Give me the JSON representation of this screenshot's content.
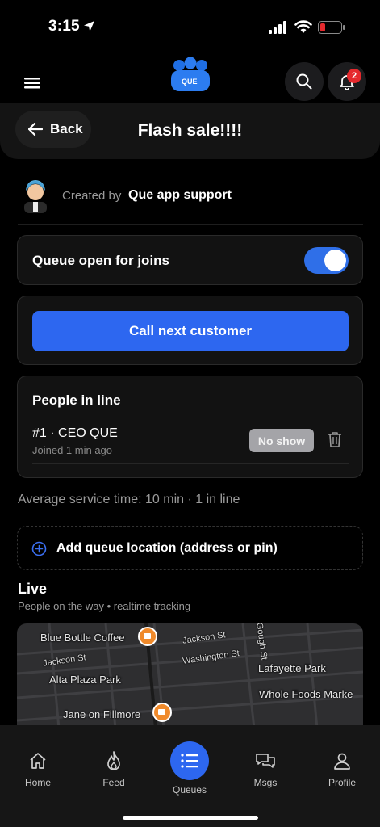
{
  "status_bar": {
    "time": "3:15"
  },
  "header": {
    "logo_text": "QUE",
    "notification_count": "2"
  },
  "title_bar": {
    "back_label": "Back",
    "title": "Flash sale!!!!"
  },
  "creator": {
    "created_by_label": "Created by",
    "name": "Que app support"
  },
  "queue_toggle": {
    "label": "Queue open for joins",
    "on": true
  },
  "call_next": {
    "label": "Call next customer"
  },
  "people_in_line": {
    "title": "People in line",
    "rows": [
      {
        "name": "#1 · CEO QUE",
        "joined": "Joined 1 min ago",
        "action": "No show"
      }
    ]
  },
  "average_line": "Average service time: 10 min · 1 in line",
  "add_location": {
    "label": "Add queue location (address or pin)"
  },
  "live": {
    "title": "Live",
    "subtitle": "People on the way • realtime tracking"
  },
  "map": {
    "labels": {
      "blue_bottle": "Blue Bottle Coffee",
      "jackson_st_1": "Jackson St",
      "jackson_st_2": "Jackson St",
      "washington_st": "Washington St",
      "alta_plaza": "Alta Plaza Park",
      "lafayette": "Lafayette Park",
      "whole_foods": "Whole Foods Marke",
      "jane_fillmore": "Jane on Fillmore",
      "gough_st": "Gough St"
    }
  },
  "tabs": {
    "home": "Home",
    "feed": "Feed",
    "queues": "Queues",
    "msgs": "Msgs",
    "profile": "Profile"
  },
  "colors": {
    "accent": "#2d67f0",
    "badge": "#e5292d",
    "pin": "#f08a2b"
  }
}
